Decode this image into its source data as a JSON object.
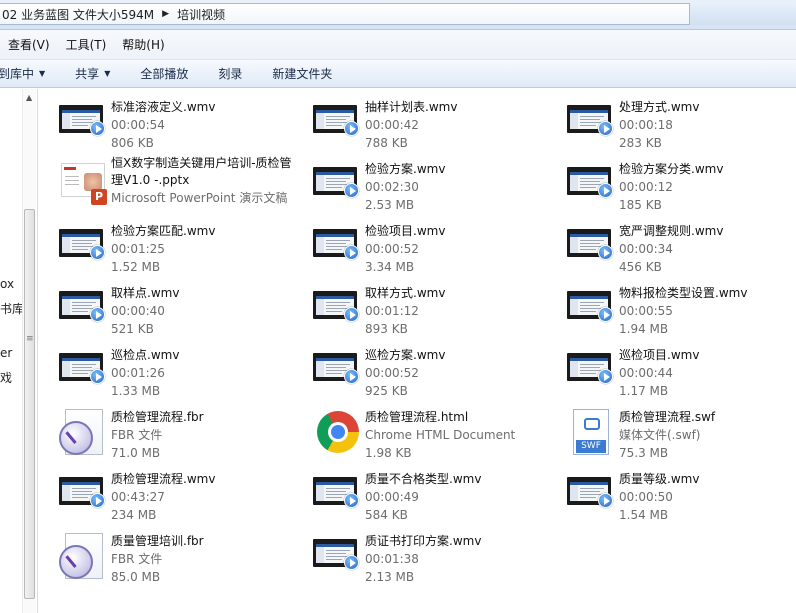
{
  "address": {
    "segment1": "02 业务蓝图 文件大小594M",
    "segment2": "培训视频"
  },
  "menu": [
    "查看(V)",
    "工具(T)",
    "帮助(H)"
  ],
  "toolbar": {
    "include_library": "到库中",
    "share": "共享",
    "play_all": "全部播放",
    "burn": "刻录",
    "new_folder": "新建文件夹"
  },
  "nav": {
    "labels": [
      "ox",
      "书库",
      "er",
      "戏"
    ]
  },
  "files": [
    {
      "name": "标准溶液定义.wmv",
      "line2": "00:00:54",
      "line3": "806 KB",
      "icon": "video"
    },
    {
      "name": "抽样计划表.wmv",
      "line2": "00:00:42",
      "line3": "788 KB",
      "icon": "video"
    },
    {
      "name": "处理方式.wmv",
      "line2": "00:00:18",
      "line3": "283 KB",
      "icon": "video"
    },
    {
      "name": "恒X数字制造关键用户培训-质检管理V1.0 -.pptx",
      "line2": "Microsoft PowerPoint 演示文稿",
      "line3": "",
      "icon": "pptx"
    },
    {
      "name": "检验方案.wmv",
      "line2": "00:02:30",
      "line3": "2.53 MB",
      "icon": "video"
    },
    {
      "name": "检验方案分类.wmv",
      "line2": "00:00:12",
      "line3": "185 KB",
      "icon": "video"
    },
    {
      "name": "检验方案匹配.wmv",
      "line2": "00:01:25",
      "line3": "1.52 MB",
      "icon": "video"
    },
    {
      "name": "检验项目.wmv",
      "line2": "00:00:52",
      "line3": "3.34 MB",
      "icon": "video"
    },
    {
      "name": "宽严调整规则.wmv",
      "line2": "00:00:34",
      "line3": "456 KB",
      "icon": "video"
    },
    {
      "name": "取样点.wmv",
      "line2": "00:00:40",
      "line3": "521 KB",
      "icon": "video"
    },
    {
      "name": "取样方式.wmv",
      "line2": "00:01:12",
      "line3": "893 KB",
      "icon": "video"
    },
    {
      "name": "物料报检类型设置.wmv",
      "line2": "00:00:55",
      "line3": "1.94 MB",
      "icon": "video"
    },
    {
      "name": "巡检点.wmv",
      "line2": "00:01:26",
      "line3": "1.33 MB",
      "icon": "video"
    },
    {
      "name": "巡检方案.wmv",
      "line2": "00:00:52",
      "line3": "925 KB",
      "icon": "video"
    },
    {
      "name": "巡检项目.wmv",
      "line2": "00:00:44",
      "line3": "1.17 MB",
      "icon": "video"
    },
    {
      "name": "质检管理流程.fbr",
      "line2": "FBR 文件",
      "line3": "71.0 MB",
      "icon": "fbr"
    },
    {
      "name": "质检管理流程.html",
      "line2": "Chrome HTML Document",
      "line3": "1.98 KB",
      "icon": "chrome"
    },
    {
      "name": "质检管理流程.swf",
      "line2": "媒体文件(.swf)",
      "line3": "75.3 MB",
      "icon": "swf"
    },
    {
      "name": "质检管理流程.wmv",
      "line2": "00:43:27",
      "line3": "234 MB",
      "icon": "video"
    },
    {
      "name": "质量不合格类型.wmv",
      "line2": "00:00:49",
      "line3": "584 KB",
      "icon": "video"
    },
    {
      "name": "质量等级.wmv",
      "line2": "00:00:50",
      "line3": "1.54 MB",
      "icon": "video"
    },
    {
      "name": "质量管理培训.fbr",
      "line2": "FBR 文件",
      "line3": "85.0 MB",
      "icon": "fbr"
    },
    {
      "name": "质证书打印方案.wmv",
      "line2": "00:01:38",
      "line3": "2.13 MB",
      "icon": "video"
    }
  ],
  "swf_badge": "SWF",
  "ppt_badge": "P"
}
